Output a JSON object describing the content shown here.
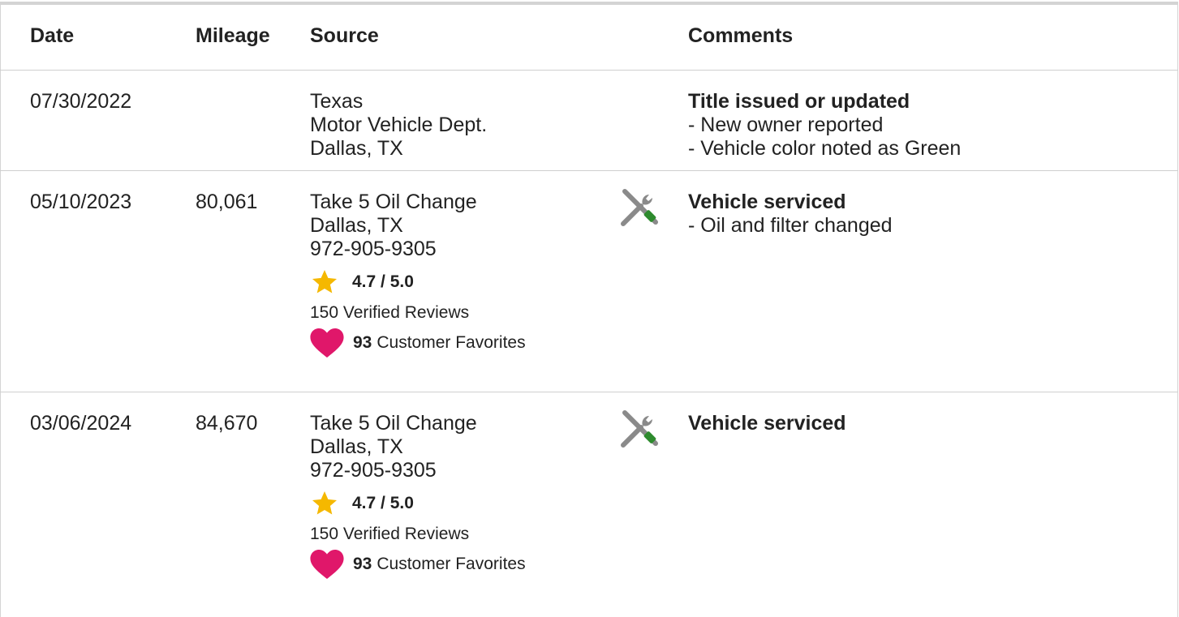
{
  "headers": {
    "date": "Date",
    "mileage": "Mileage",
    "source": "Source",
    "comments": "Comments"
  },
  "rows": [
    {
      "date": "07/30/2022",
      "mileage": "",
      "source": [
        "Texas",
        "Motor Vehicle Dept.",
        "Dallas, TX"
      ],
      "comment_title": "Title issued or updated",
      "bullets": [
        "- New owner reported",
        "- Vehicle color noted as Green"
      ]
    },
    {
      "date": "05/10/2023",
      "mileage": "80,061",
      "source": [
        "Take 5 Oil Change",
        "Dallas, TX",
        "972-905-9305"
      ],
      "rating": "4.7 / 5.0",
      "reviews": "150 Verified Reviews",
      "favorites_count": "93",
      "favorites_label": "Customer Favorites",
      "comment_title": "Vehicle serviced",
      "bullets": [
        "- Oil and filter changed"
      ]
    },
    {
      "date": "03/06/2024",
      "mileage": "84,670",
      "source": [
        "Take 5 Oil Change",
        "Dallas, TX",
        "972-905-9305"
      ],
      "rating": "4.7 / 5.0",
      "reviews": "150 Verified Reviews",
      "favorites_count": "93",
      "favorites_label": "Customer Favorites",
      "comment_title": "Vehicle serviced",
      "bullets": []
    }
  ],
  "icons": {
    "star": "star-icon",
    "heart": "heart-icon",
    "service": "service-tools-icon"
  },
  "colors": {
    "star": "#f5b800",
    "heart": "#e0176a",
    "tools_gray": "#8a8a8a",
    "tools_green": "#2e8b2e",
    "border": "#d4d4d4"
  }
}
